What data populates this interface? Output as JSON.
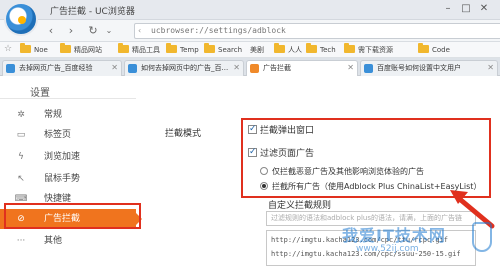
{
  "window": {
    "title": "广告拦截 - UC浏览器"
  },
  "address": {
    "url": "ucbrowser://settings/adblock"
  },
  "bookmarks": [
    "Noe",
    "精品网站",
    "精品工具",
    "Temp",
    "Search",
    "美剧",
    "人人",
    "Tech",
    "需下载资源",
    "Code"
  ],
  "tabs": [
    {
      "label": "去掉网页广告_百度经验",
      "active": false
    },
    {
      "label": "如何去掉网页中的广告_百...",
      "active": false
    },
    {
      "label": "广告拦截",
      "active": true
    },
    {
      "label": "百度账号如何设置中文用户",
      "active": false
    }
  ],
  "settings": {
    "title": "设置"
  },
  "sidebar": {
    "items": [
      {
        "icon": "gear-icon",
        "label": "常规"
      },
      {
        "icon": "tabs-icon",
        "label": "标签页"
      },
      {
        "icon": "lightning-icon",
        "label": "浏览加速"
      },
      {
        "icon": "mouse-icon",
        "label": "鼠标手势"
      },
      {
        "icon": "keyboard-icon",
        "label": "快捷键"
      },
      {
        "icon": "block-icon",
        "label": "广告拦截"
      },
      {
        "icon": "more-icon",
        "label": "其他"
      }
    ],
    "active_index": 5
  },
  "adblock": {
    "section_label": "拦截模式",
    "block_popup": "拦截弹出窗口",
    "filter_ads": "过滤页面广告",
    "option_mild": "仅拦截恶意广告及其他影响浏览体验的广告",
    "option_all": "拦截所有广告（使用Adblock Plus ChinaList+EasyList）",
    "custom_label": "自定义拦截规则",
    "hint": "过滤规则的语法和adblock plus的语法，请满，上面的广告链",
    "rules": [
      "http://imgtu.kacha123.com/cpc/ttu/rcpc.gif",
      "http://imgtu.kacha123.com/cpc/ssuu-250-15.gif"
    ]
  },
  "watermark": {
    "text": "我爱IT技术网",
    "url": "www.52ij.com"
  },
  "colors": {
    "accent": "#f0741e",
    "highlight": "#e0301e",
    "brand_blue": "#3a8fd8"
  }
}
